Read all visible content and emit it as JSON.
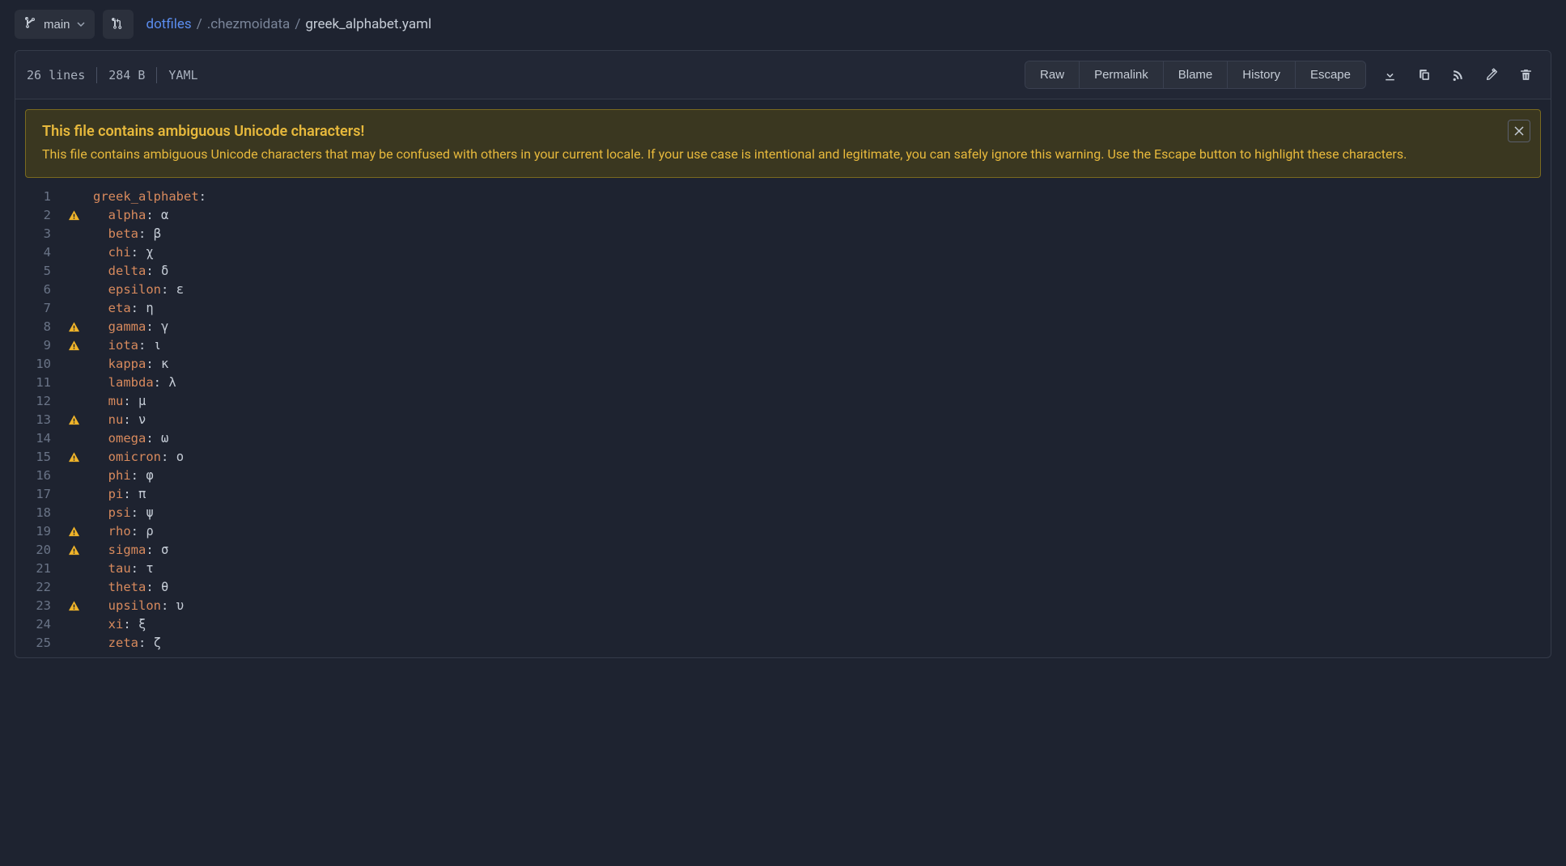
{
  "branch": {
    "name": "main"
  },
  "breadcrumb": {
    "repo": "dotfiles",
    "path": ".chezmoidata",
    "file": "greek_alphabet.yaml"
  },
  "file_meta": {
    "lines": "26 lines",
    "size": "284 B",
    "lang": "YAML"
  },
  "buttons": {
    "raw": "Raw",
    "permalink": "Permalink",
    "blame": "Blame",
    "history": "History",
    "escape": "Escape"
  },
  "warning": {
    "title": "This file contains ambiguous Unicode characters!",
    "body": "This file contains ambiguous Unicode characters that may be confused with others in your current locale. If your use case is intentional and legitimate, you can safely ignore this warning. Use the Escape button to highlight these characters."
  },
  "code": {
    "root_key": "greek_alphabet",
    "lines": [
      {
        "n": 1,
        "warn": false,
        "key": "greek_alphabet",
        "val": "",
        "indent": 0,
        "root": true
      },
      {
        "n": 2,
        "warn": true,
        "key": "alpha",
        "val": "α"
      },
      {
        "n": 3,
        "warn": false,
        "key": "beta",
        "val": "β"
      },
      {
        "n": 4,
        "warn": false,
        "key": "chi",
        "val": "χ"
      },
      {
        "n": 5,
        "warn": false,
        "key": "delta",
        "val": "δ"
      },
      {
        "n": 6,
        "warn": false,
        "key": "epsilon",
        "val": "ε"
      },
      {
        "n": 7,
        "warn": false,
        "key": "eta",
        "val": "η"
      },
      {
        "n": 8,
        "warn": true,
        "key": "gamma",
        "val": "γ"
      },
      {
        "n": 9,
        "warn": true,
        "key": "iota",
        "val": "ι"
      },
      {
        "n": 10,
        "warn": false,
        "key": "kappa",
        "val": "κ"
      },
      {
        "n": 11,
        "warn": false,
        "key": "lambda",
        "val": "λ"
      },
      {
        "n": 12,
        "warn": false,
        "key": "mu",
        "val": "μ"
      },
      {
        "n": 13,
        "warn": true,
        "key": "nu",
        "val": "ν"
      },
      {
        "n": 14,
        "warn": false,
        "key": "omega",
        "val": "ω"
      },
      {
        "n": 15,
        "warn": true,
        "key": "omicron",
        "val": "ο"
      },
      {
        "n": 16,
        "warn": false,
        "key": "phi",
        "val": "φ"
      },
      {
        "n": 17,
        "warn": false,
        "key": "pi",
        "val": "π"
      },
      {
        "n": 18,
        "warn": false,
        "key": "psi",
        "val": "ψ"
      },
      {
        "n": 19,
        "warn": true,
        "key": "rho",
        "val": "ρ"
      },
      {
        "n": 20,
        "warn": true,
        "key": "sigma",
        "val": "σ"
      },
      {
        "n": 21,
        "warn": false,
        "key": "tau",
        "val": "τ"
      },
      {
        "n": 22,
        "warn": false,
        "key": "theta",
        "val": "θ"
      },
      {
        "n": 23,
        "warn": true,
        "key": "upsilon",
        "val": "υ"
      },
      {
        "n": 24,
        "warn": false,
        "key": "xi",
        "val": "ξ"
      },
      {
        "n": 25,
        "warn": false,
        "key": "zeta",
        "val": "ζ"
      }
    ]
  }
}
